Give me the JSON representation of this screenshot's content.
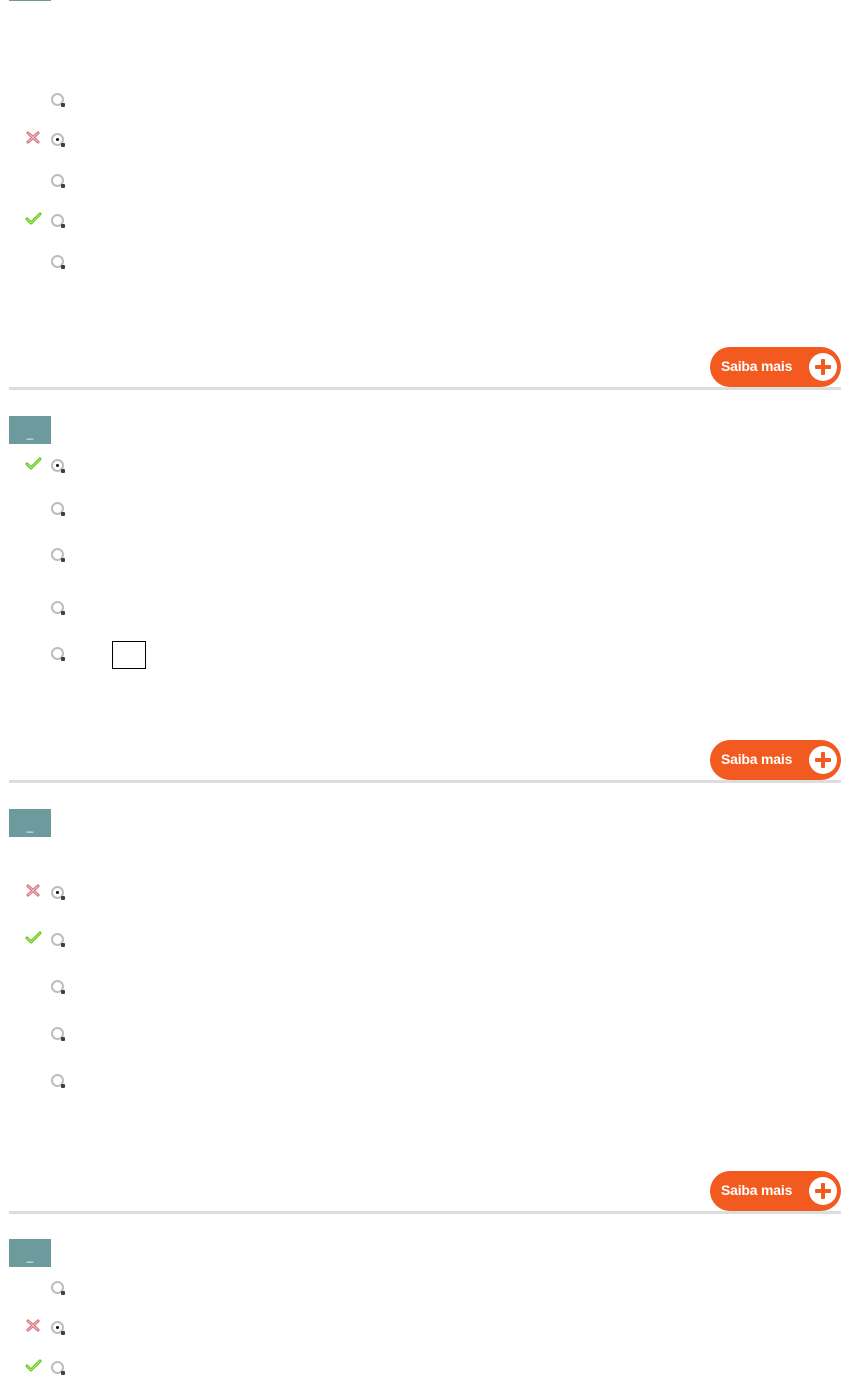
{
  "saiba_label": "Saiba mais",
  "question_tab_label": "_",
  "colors": {
    "accent_orange": "#f25a1f",
    "tab_teal": "#6d9a9c",
    "correct_green": "#6fcf1e",
    "wrong_red": "#d46a76",
    "divider": "#dddddd"
  },
  "questions": [
    {
      "options": [
        {
          "selected": false,
          "mark": "none"
        },
        {
          "selected": true,
          "mark": "wrong"
        },
        {
          "selected": false,
          "mark": "none"
        },
        {
          "selected": false,
          "mark": "correct"
        },
        {
          "selected": false,
          "mark": "none"
        }
      ]
    },
    {
      "options": [
        {
          "selected": true,
          "mark": "correct"
        },
        {
          "selected": false,
          "mark": "none"
        },
        {
          "selected": false,
          "mark": "none"
        },
        {
          "selected": false,
          "mark": "none"
        },
        {
          "selected": false,
          "mark": "none",
          "has_answer_box": true
        }
      ]
    },
    {
      "options": [
        {
          "selected": true,
          "mark": "wrong"
        },
        {
          "selected": false,
          "mark": "correct"
        },
        {
          "selected": false,
          "mark": "none"
        },
        {
          "selected": false,
          "mark": "none"
        },
        {
          "selected": false,
          "mark": "none"
        }
      ]
    },
    {
      "options": [
        {
          "selected": false,
          "mark": "none"
        },
        {
          "selected": true,
          "mark": "wrong"
        },
        {
          "selected": false,
          "mark": "correct"
        }
      ]
    }
  ]
}
